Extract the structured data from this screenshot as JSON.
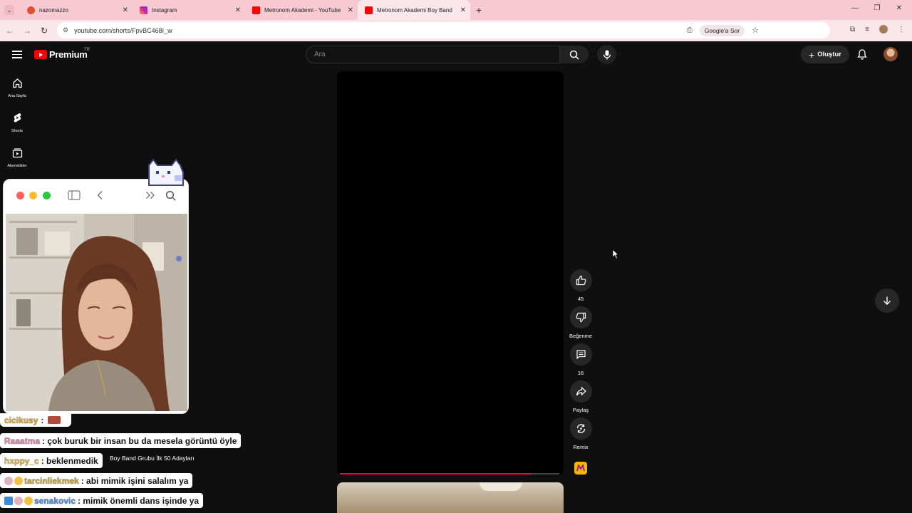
{
  "browser": {
    "tabs": [
      {
        "title": "nazomazzo",
        "fav_color": "#e0522e",
        "active": false
      },
      {
        "title": "Instagram",
        "fav_color": "#d6249f",
        "active": false
      },
      {
        "title": "Metronom Akademi - YouTube",
        "fav_color": "#ff0000",
        "active": false
      },
      {
        "title": "Metronom Akademi Boy Band",
        "fav_color": "#ff0000",
        "active": true
      }
    ],
    "url": "youtube.com/shorts/FpvBC468I_w",
    "google_sor": "Google'a Sor"
  },
  "header": {
    "logo_text": "Premium",
    "region": "TR",
    "search_placeholder": "Ara",
    "create_label": "Oluştur"
  },
  "sidebar": {
    "items": [
      {
        "label": "Ana Sayfa"
      },
      {
        "label": "Shorts"
      },
      {
        "label": "Abonelikler"
      }
    ]
  },
  "shorts": {
    "progress_fraction": 0.87,
    "like_count": "45",
    "dislike_label": "Beğenme",
    "comment_count": "16",
    "share_label": "Paylaş",
    "remix_label": "Remix"
  },
  "overlay": {
    "caption": "Boy Band Grubu İlk 50 Adayları",
    "chat": [
      {
        "user": "cicikusy",
        "message": ":",
        "user_color": "#d9a23a"
      },
      {
        "user": "Raaatma",
        "message": ": çok buruk bir insan bu da mesela görüntü öyle",
        "user_color": "#d98aa8"
      },
      {
        "user": "hxppy_c",
        "message": ": beklenmedik",
        "user_color": "#d9b24a"
      },
      {
        "user": "tarcinliekmek",
        "message": ": abi mimik işini salalım ya",
        "user_color": "#c9a23a"
      },
      {
        "user": "senakovic",
        "message": ": mimik önemli dans işinde ya",
        "user_color": "#4a8ad9"
      }
    ]
  },
  "colors": {
    "tab_bar": "#f6c9d3",
    "yt_background": "#0f0f0f",
    "progress": "#ff0033"
  }
}
